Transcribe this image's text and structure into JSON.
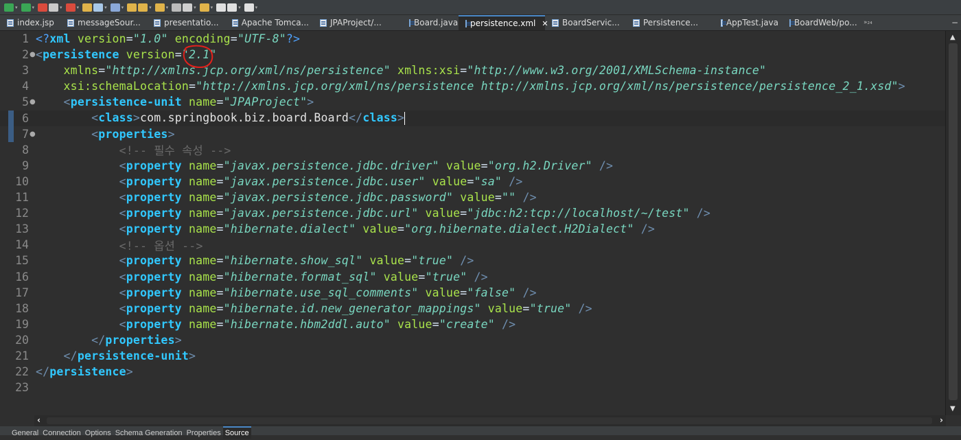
{
  "toolbar": {
    "icons": [
      "run-icon",
      "debug-icon",
      "external-tools-icon",
      "new-icon",
      "new-server-icon",
      "open-perspective-icon",
      "wizard-icon",
      "search-icon",
      "open-type-icon",
      "open-task-icon",
      "open-folder-icon",
      "pin-icon",
      "annotation-icon",
      "next-annotation-icon",
      "back-icon",
      "forward-icon",
      "last-edit-icon"
    ]
  },
  "tabs": [
    {
      "label": "index.jsp",
      "icon": "file-icon",
      "active": false
    },
    {
      "label": "messageSour...",
      "icon": "xml-file-icon",
      "active": false
    },
    {
      "label": "presentatio...",
      "icon": "java-file-icon",
      "active": false
    },
    {
      "label": "Apache Tomca...",
      "icon": "server-icon",
      "active": false
    },
    {
      "label": "JPAProject/...",
      "icon": "xml-file-icon",
      "active": false
    },
    {
      "label": "Board.java",
      "icon": "java-file-icon",
      "active": false
    },
    {
      "label": "persistence.xml",
      "icon": "xml-file-icon",
      "active": true
    },
    {
      "label": "BoardServic...",
      "icon": "java-file-icon",
      "active": false
    },
    {
      "label": "Persistence...",
      "icon": "java-file-icon",
      "active": false
    },
    {
      "label": "AppTest.java",
      "icon": "java-file-icon",
      "active": false
    },
    {
      "label": "BoardWeb/po...",
      "icon": "xml-file-icon",
      "active": false
    }
  ],
  "tab_overflow": "»₂₄",
  "editor": {
    "file": "persistence.xml",
    "current_line": 6,
    "lines": [
      {
        "n": "1",
        "fold": "",
        "tokens": [
          [
            "t-pi",
            "<?"
          ],
          [
            "t-tag",
            "xml"
          ],
          [
            "t-txt",
            " "
          ],
          [
            "t-attr",
            "version"
          ],
          [
            "t-eq",
            "="
          ],
          [
            "t-str",
            "\"1.0\""
          ],
          [
            "t-txt",
            " "
          ],
          [
            "t-attr",
            "encoding"
          ],
          [
            "t-eq",
            "="
          ],
          [
            "t-str",
            "\"UTF-8\""
          ],
          [
            "t-pi",
            "?>"
          ]
        ]
      },
      {
        "n": "2",
        "fold": "●",
        "tokens": [
          [
            "t-punc",
            "<"
          ],
          [
            "t-tag",
            "persistence"
          ],
          [
            "t-txt",
            " "
          ],
          [
            "t-attr",
            "version"
          ],
          [
            "t-eq",
            "="
          ],
          [
            "t-str",
            "\"2.1\""
          ]
        ]
      },
      {
        "n": "3",
        "fold": "",
        "tokens": [
          [
            "t-txt",
            "    "
          ],
          [
            "t-attr",
            "xmlns"
          ],
          [
            "t-eq",
            "="
          ],
          [
            "t-str",
            "\"http://xmlns.jcp.org/xml/ns/persistence\""
          ],
          [
            "t-txt",
            " "
          ],
          [
            "t-attr",
            "xmlns:xsi"
          ],
          [
            "t-eq",
            "="
          ],
          [
            "t-str",
            "\"http://www.w3.org/2001/XMLSchema-instance\""
          ]
        ]
      },
      {
        "n": "4",
        "fold": "",
        "tokens": [
          [
            "t-txt",
            "    "
          ],
          [
            "t-attr",
            "xsi:schemaLocation"
          ],
          [
            "t-eq",
            "="
          ],
          [
            "t-str",
            "\"http://xmlns.jcp.org/xml/ns/persistence http://xmlns.jcp.org/xml/ns/persistence/persistence_2_1.xsd\""
          ],
          [
            "t-punc",
            ">"
          ]
        ]
      },
      {
        "n": "5",
        "fold": "●",
        "tokens": [
          [
            "t-txt",
            "    "
          ],
          [
            "t-punc",
            "<"
          ],
          [
            "t-tag",
            "persistence-unit"
          ],
          [
            "t-txt",
            " "
          ],
          [
            "t-attr",
            "name"
          ],
          [
            "t-eq",
            "="
          ],
          [
            "t-str",
            "\"JPAProject\""
          ],
          [
            "t-punc",
            ">"
          ]
        ]
      },
      {
        "n": "6",
        "fold": "",
        "tokens": [
          [
            "t-txt",
            "        "
          ],
          [
            "t-punc",
            "<"
          ],
          [
            "t-tag",
            "class"
          ],
          [
            "t-punc",
            ">"
          ],
          [
            "t-txt",
            "com.springbook.biz.board.Board"
          ],
          [
            "t-punc",
            "</"
          ],
          [
            "t-tag",
            "class"
          ],
          [
            "t-punc",
            ">"
          ]
        ]
      },
      {
        "n": "7",
        "fold": "●",
        "tokens": [
          [
            "t-txt",
            "        "
          ],
          [
            "t-punc",
            "<"
          ],
          [
            "t-tag",
            "properties"
          ],
          [
            "t-punc",
            ">"
          ]
        ]
      },
      {
        "n": "8",
        "fold": "",
        "tokens": [
          [
            "t-txt",
            "            "
          ],
          [
            "t-cmt",
            "<!-- 필수 속성 -->"
          ]
        ]
      },
      {
        "n": "9",
        "fold": "",
        "tokens": [
          [
            "t-txt",
            "            "
          ],
          [
            "t-punc",
            "<"
          ],
          [
            "t-tag",
            "property"
          ],
          [
            "t-txt",
            " "
          ],
          [
            "t-attr",
            "name"
          ],
          [
            "t-eq",
            "="
          ],
          [
            "t-str",
            "\"javax.persistence.jdbc.driver\""
          ],
          [
            "t-txt",
            " "
          ],
          [
            "t-attr",
            "value"
          ],
          [
            "t-eq",
            "="
          ],
          [
            "t-str",
            "\"org.h2.Driver\""
          ],
          [
            "t-txt",
            " "
          ],
          [
            "t-punc",
            "/>"
          ]
        ]
      },
      {
        "n": "10",
        "fold": "",
        "tokens": [
          [
            "t-txt",
            "            "
          ],
          [
            "t-punc",
            "<"
          ],
          [
            "t-tag",
            "property"
          ],
          [
            "t-txt",
            " "
          ],
          [
            "t-attr",
            "name"
          ],
          [
            "t-eq",
            "="
          ],
          [
            "t-str",
            "\"javax.persistence.jdbc.user\""
          ],
          [
            "t-txt",
            " "
          ],
          [
            "t-attr",
            "value"
          ],
          [
            "t-eq",
            "="
          ],
          [
            "t-str",
            "\"sa\""
          ],
          [
            "t-txt",
            " "
          ],
          [
            "t-punc",
            "/>"
          ]
        ]
      },
      {
        "n": "11",
        "fold": "",
        "tokens": [
          [
            "t-txt",
            "            "
          ],
          [
            "t-punc",
            "<"
          ],
          [
            "t-tag",
            "property"
          ],
          [
            "t-txt",
            " "
          ],
          [
            "t-attr",
            "name"
          ],
          [
            "t-eq",
            "="
          ],
          [
            "t-str",
            "\"javax.persistence.jdbc.password\""
          ],
          [
            "t-txt",
            " "
          ],
          [
            "t-attr",
            "value"
          ],
          [
            "t-eq",
            "="
          ],
          [
            "t-str",
            "\"\""
          ],
          [
            "t-txt",
            " "
          ],
          [
            "t-punc",
            "/>"
          ]
        ]
      },
      {
        "n": "12",
        "fold": "",
        "tokens": [
          [
            "t-txt",
            "            "
          ],
          [
            "t-punc",
            "<"
          ],
          [
            "t-tag",
            "property"
          ],
          [
            "t-txt",
            " "
          ],
          [
            "t-attr",
            "name"
          ],
          [
            "t-eq",
            "="
          ],
          [
            "t-str",
            "\"javax.persistence.jdbc.url\""
          ],
          [
            "t-txt",
            " "
          ],
          [
            "t-attr",
            "value"
          ],
          [
            "t-eq",
            "="
          ],
          [
            "t-str",
            "\"jdbc:h2:tcp://localhost/~/test\""
          ],
          [
            "t-txt",
            " "
          ],
          [
            "t-punc",
            "/>"
          ]
        ]
      },
      {
        "n": "13",
        "fold": "",
        "tokens": [
          [
            "t-txt",
            "            "
          ],
          [
            "t-punc",
            "<"
          ],
          [
            "t-tag",
            "property"
          ],
          [
            "t-txt",
            " "
          ],
          [
            "t-attr",
            "name"
          ],
          [
            "t-eq",
            "="
          ],
          [
            "t-str",
            "\"hibernate.dialect\""
          ],
          [
            "t-txt",
            " "
          ],
          [
            "t-attr",
            "value"
          ],
          [
            "t-eq",
            "="
          ],
          [
            "t-str",
            "\"org.hibernate.dialect.H2Dialect\""
          ],
          [
            "t-txt",
            " "
          ],
          [
            "t-punc",
            "/>"
          ]
        ]
      },
      {
        "n": "14",
        "fold": "",
        "tokens": [
          [
            "t-txt",
            "            "
          ],
          [
            "t-cmt",
            "<!-- 옵션 -->"
          ]
        ]
      },
      {
        "n": "15",
        "fold": "",
        "tokens": [
          [
            "t-txt",
            "            "
          ],
          [
            "t-punc",
            "<"
          ],
          [
            "t-tag",
            "property"
          ],
          [
            "t-txt",
            " "
          ],
          [
            "t-attr",
            "name"
          ],
          [
            "t-eq",
            "="
          ],
          [
            "t-str",
            "\"hibernate.show_sql\""
          ],
          [
            "t-txt",
            " "
          ],
          [
            "t-attr",
            "value"
          ],
          [
            "t-eq",
            "="
          ],
          [
            "t-str",
            "\"true\""
          ],
          [
            "t-txt",
            " "
          ],
          [
            "t-punc",
            "/>"
          ]
        ]
      },
      {
        "n": "16",
        "fold": "",
        "tokens": [
          [
            "t-txt",
            "            "
          ],
          [
            "t-punc",
            "<"
          ],
          [
            "t-tag",
            "property"
          ],
          [
            "t-txt",
            " "
          ],
          [
            "t-attr",
            "name"
          ],
          [
            "t-eq",
            "="
          ],
          [
            "t-str",
            "\"hibernate.format_sql\""
          ],
          [
            "t-txt",
            " "
          ],
          [
            "t-attr",
            "value"
          ],
          [
            "t-eq",
            "="
          ],
          [
            "t-str",
            "\"true\""
          ],
          [
            "t-txt",
            " "
          ],
          [
            "t-punc",
            "/>"
          ]
        ]
      },
      {
        "n": "17",
        "fold": "",
        "tokens": [
          [
            "t-txt",
            "            "
          ],
          [
            "t-punc",
            "<"
          ],
          [
            "t-tag",
            "property"
          ],
          [
            "t-txt",
            " "
          ],
          [
            "t-attr",
            "name"
          ],
          [
            "t-eq",
            "="
          ],
          [
            "t-str",
            "\"hibernate.use_sql_comments\""
          ],
          [
            "t-txt",
            " "
          ],
          [
            "t-attr",
            "value"
          ],
          [
            "t-eq",
            "="
          ],
          [
            "t-str",
            "\"false\""
          ],
          [
            "t-txt",
            " "
          ],
          [
            "t-punc",
            "/>"
          ]
        ]
      },
      {
        "n": "18",
        "fold": "",
        "tokens": [
          [
            "t-txt",
            "            "
          ],
          [
            "t-punc",
            "<"
          ],
          [
            "t-tag",
            "property"
          ],
          [
            "t-txt",
            " "
          ],
          [
            "t-attr",
            "name"
          ],
          [
            "t-eq",
            "="
          ],
          [
            "t-str",
            "\"hibernate.id.new_generator_mappings\""
          ],
          [
            "t-txt",
            " "
          ],
          [
            "t-attr",
            "value"
          ],
          [
            "t-eq",
            "="
          ],
          [
            "t-str",
            "\"true\""
          ],
          [
            "t-txt",
            " "
          ],
          [
            "t-punc",
            "/>"
          ]
        ]
      },
      {
        "n": "19",
        "fold": "",
        "tokens": [
          [
            "t-txt",
            "            "
          ],
          [
            "t-punc",
            "<"
          ],
          [
            "t-tag",
            "property"
          ],
          [
            "t-txt",
            " "
          ],
          [
            "t-attr",
            "name"
          ],
          [
            "t-eq",
            "="
          ],
          [
            "t-str",
            "\"hibernate.hbm2ddl.auto\""
          ],
          [
            "t-txt",
            " "
          ],
          [
            "t-attr",
            "value"
          ],
          [
            "t-eq",
            "="
          ],
          [
            "t-str",
            "\"create\""
          ],
          [
            "t-txt",
            " "
          ],
          [
            "t-punc",
            "/>"
          ]
        ]
      },
      {
        "n": "20",
        "fold": "",
        "tokens": [
          [
            "t-txt",
            "        "
          ],
          [
            "t-punc",
            "</"
          ],
          [
            "t-tag",
            "properties"
          ],
          [
            "t-punc",
            ">"
          ]
        ]
      },
      {
        "n": "21",
        "fold": "",
        "tokens": [
          [
            "t-txt",
            "    "
          ],
          [
            "t-punc",
            "</"
          ],
          [
            "t-tag",
            "persistence-unit"
          ],
          [
            "t-punc",
            ">"
          ]
        ]
      },
      {
        "n": "22",
        "fold": "",
        "tokens": [
          [
            "t-punc",
            "</"
          ],
          [
            "t-tag",
            "persistence"
          ],
          [
            "t-punc",
            ">"
          ]
        ]
      },
      {
        "n": "23",
        "fold": "",
        "tokens": []
      }
    ]
  },
  "bottom_tabs": [
    {
      "label": "General",
      "active": false
    },
    {
      "label": "Connection",
      "active": false
    },
    {
      "label": "Options",
      "active": false
    },
    {
      "label": "Schema Generation",
      "active": false
    },
    {
      "label": "Properties",
      "active": false
    },
    {
      "label": "Source",
      "active": true
    }
  ],
  "colors": {
    "accent": "#4a88c7",
    "tag": "#31c8ff",
    "attr": "#a9e34b",
    "string": "#79d7c0",
    "annotation_circle": "#e3211c"
  }
}
